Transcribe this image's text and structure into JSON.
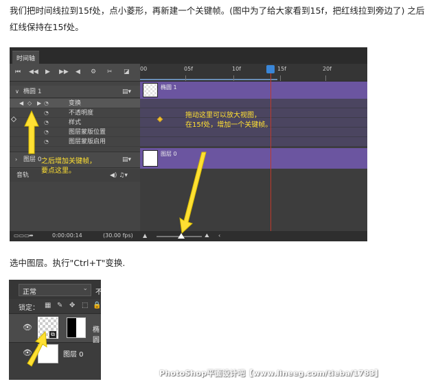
{
  "article": {
    "paragraph1": "我们把时间线拉到15f处，点小菱形，再新建一个关键帧。(图中为了给大家看到15f，把红线拉到旁边了) 之后红线保持在15f处。",
    "paragraph2": "选中图层。执行\"Ctrl+T\"变换."
  },
  "timeline": {
    "tab_label": "时间轴",
    "controls": [
      "⏮",
      "◀◀",
      "▶",
      "▶▶",
      "◀",
      "⚙",
      "✂",
      "◪"
    ],
    "ruler_labels": [
      "00",
      "05f",
      "10f",
      "15f",
      "20f"
    ],
    "layers": {
      "ellipse_name": "椭圆 1",
      "properties": [
        "变换",
        "不透明度",
        "样式",
        "图层蒙版位置",
        "图层蒙版启用"
      ],
      "layer0_name": "图层 0",
      "audio_label": "音轨"
    },
    "bars": {
      "ellipse_label": "椭圆 1",
      "layer0_label": "图层 0"
    },
    "footer": {
      "timecode": "0:00:00:14",
      "fps": "(30.00 fps)"
    },
    "annotations": {
      "drag": "拖动这里可以放大视图，\n在15f处，增加一个关键帧。",
      "add_key": "之后增加关键帧，\n要点这里。"
    },
    "playhead_frame": "15f",
    "annotation_color": "#ffe033",
    "bar_color": "#6b55a0",
    "playhead_color": "#c0392b"
  },
  "layers_panel": {
    "blend_mode": "正常",
    "blend_cut": "不",
    "lock_label": "锁定：",
    "lock_icons": [
      "▦",
      "✎",
      "✥",
      "⬚",
      "🔒"
    ],
    "layer_ellipse_name": "椭圆",
    "layer0_name": "图层 0",
    "smart_badge": "⧉"
  },
  "watermark": "PhotoShop平面设计吧【www.lineeg.com/tieba/1783】"
}
